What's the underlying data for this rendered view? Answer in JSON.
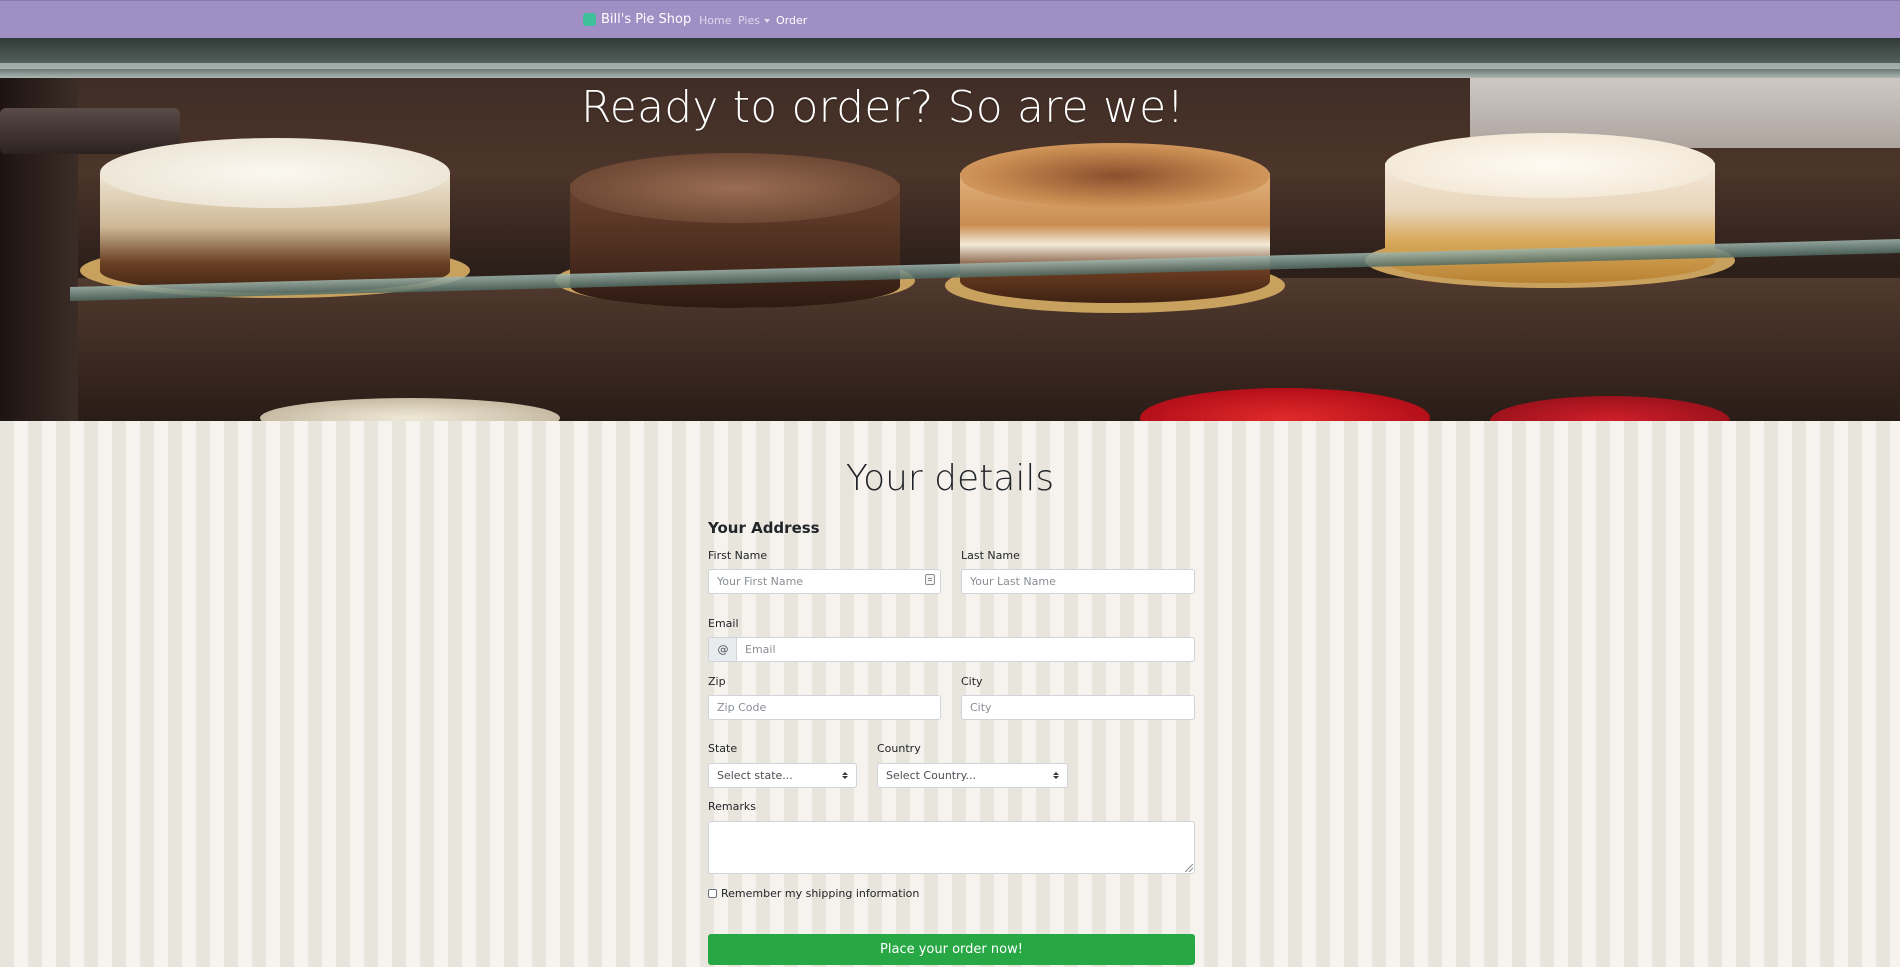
{
  "navbar": {
    "brand": "Bill's Pie Shop",
    "links": [
      {
        "label": "Home"
      },
      {
        "label": "Pies"
      },
      {
        "label": "Order"
      }
    ]
  },
  "hero": {
    "title": "Ready to order? So are we!"
  },
  "form": {
    "title": "Your details",
    "section_heading": "Your Address",
    "first_name": {
      "label": "First Name",
      "placeholder": "Your First Name",
      "value": ""
    },
    "last_name": {
      "label": "Last Name",
      "placeholder": "Your Last Name",
      "value": ""
    },
    "email": {
      "label": "Email",
      "addon": "@",
      "placeholder": "Email",
      "value": ""
    },
    "zip": {
      "label": "Zip",
      "placeholder": "Zip Code",
      "value": ""
    },
    "city": {
      "label": "City",
      "placeholder": "City",
      "value": ""
    },
    "state": {
      "label": "State",
      "selected": "Select state..."
    },
    "country": {
      "label": "Country",
      "selected": "Select Country..."
    },
    "remarks": {
      "label": "Remarks",
      "value": ""
    },
    "remember": {
      "label": "Remember my shipping information",
      "checked": false
    },
    "submit_label": "Place your order now!"
  },
  "colors": {
    "navbar": "#a08fc4",
    "submit": "#28a745",
    "stripe_dark": "#e8e5dc",
    "stripe_light": "#f6f3ee"
  }
}
